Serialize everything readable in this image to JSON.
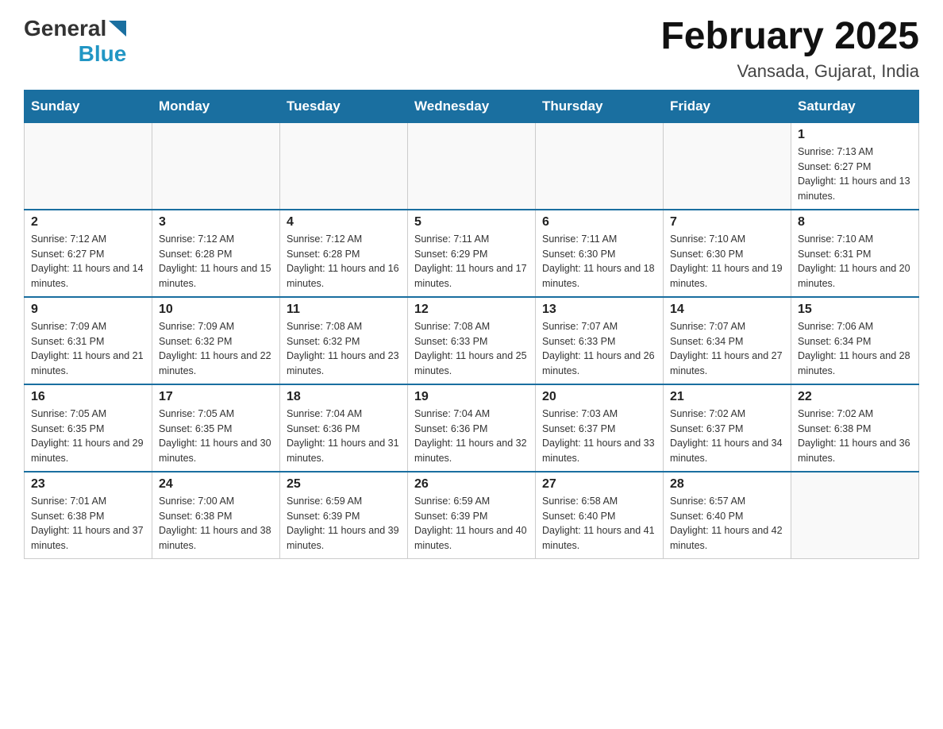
{
  "logo": {
    "general": "General",
    "blue": "Blue"
  },
  "title": "February 2025",
  "subtitle": "Vansada, Gujarat, India",
  "weekdays": [
    "Sunday",
    "Monday",
    "Tuesday",
    "Wednesday",
    "Thursday",
    "Friday",
    "Saturday"
  ],
  "weeks": [
    [
      {
        "day": "",
        "sunrise": "",
        "sunset": "",
        "daylight": ""
      },
      {
        "day": "",
        "sunrise": "",
        "sunset": "",
        "daylight": ""
      },
      {
        "day": "",
        "sunrise": "",
        "sunset": "",
        "daylight": ""
      },
      {
        "day": "",
        "sunrise": "",
        "sunset": "",
        "daylight": ""
      },
      {
        "day": "",
        "sunrise": "",
        "sunset": "",
        "daylight": ""
      },
      {
        "day": "",
        "sunrise": "",
        "sunset": "",
        "daylight": ""
      },
      {
        "day": "1",
        "sunrise": "Sunrise: 7:13 AM",
        "sunset": "Sunset: 6:27 PM",
        "daylight": "Daylight: 11 hours and 13 minutes."
      }
    ],
    [
      {
        "day": "2",
        "sunrise": "Sunrise: 7:12 AM",
        "sunset": "Sunset: 6:27 PM",
        "daylight": "Daylight: 11 hours and 14 minutes."
      },
      {
        "day": "3",
        "sunrise": "Sunrise: 7:12 AM",
        "sunset": "Sunset: 6:28 PM",
        "daylight": "Daylight: 11 hours and 15 minutes."
      },
      {
        "day": "4",
        "sunrise": "Sunrise: 7:12 AM",
        "sunset": "Sunset: 6:28 PM",
        "daylight": "Daylight: 11 hours and 16 minutes."
      },
      {
        "day": "5",
        "sunrise": "Sunrise: 7:11 AM",
        "sunset": "Sunset: 6:29 PM",
        "daylight": "Daylight: 11 hours and 17 minutes."
      },
      {
        "day": "6",
        "sunrise": "Sunrise: 7:11 AM",
        "sunset": "Sunset: 6:30 PM",
        "daylight": "Daylight: 11 hours and 18 minutes."
      },
      {
        "day": "7",
        "sunrise": "Sunrise: 7:10 AM",
        "sunset": "Sunset: 6:30 PM",
        "daylight": "Daylight: 11 hours and 19 minutes."
      },
      {
        "day": "8",
        "sunrise": "Sunrise: 7:10 AM",
        "sunset": "Sunset: 6:31 PM",
        "daylight": "Daylight: 11 hours and 20 minutes."
      }
    ],
    [
      {
        "day": "9",
        "sunrise": "Sunrise: 7:09 AM",
        "sunset": "Sunset: 6:31 PM",
        "daylight": "Daylight: 11 hours and 21 minutes."
      },
      {
        "day": "10",
        "sunrise": "Sunrise: 7:09 AM",
        "sunset": "Sunset: 6:32 PM",
        "daylight": "Daylight: 11 hours and 22 minutes."
      },
      {
        "day": "11",
        "sunrise": "Sunrise: 7:08 AM",
        "sunset": "Sunset: 6:32 PM",
        "daylight": "Daylight: 11 hours and 23 minutes."
      },
      {
        "day": "12",
        "sunrise": "Sunrise: 7:08 AM",
        "sunset": "Sunset: 6:33 PM",
        "daylight": "Daylight: 11 hours and 25 minutes."
      },
      {
        "day": "13",
        "sunrise": "Sunrise: 7:07 AM",
        "sunset": "Sunset: 6:33 PM",
        "daylight": "Daylight: 11 hours and 26 minutes."
      },
      {
        "day": "14",
        "sunrise": "Sunrise: 7:07 AM",
        "sunset": "Sunset: 6:34 PM",
        "daylight": "Daylight: 11 hours and 27 minutes."
      },
      {
        "day": "15",
        "sunrise": "Sunrise: 7:06 AM",
        "sunset": "Sunset: 6:34 PM",
        "daylight": "Daylight: 11 hours and 28 minutes."
      }
    ],
    [
      {
        "day": "16",
        "sunrise": "Sunrise: 7:05 AM",
        "sunset": "Sunset: 6:35 PM",
        "daylight": "Daylight: 11 hours and 29 minutes."
      },
      {
        "day": "17",
        "sunrise": "Sunrise: 7:05 AM",
        "sunset": "Sunset: 6:35 PM",
        "daylight": "Daylight: 11 hours and 30 minutes."
      },
      {
        "day": "18",
        "sunrise": "Sunrise: 7:04 AM",
        "sunset": "Sunset: 6:36 PM",
        "daylight": "Daylight: 11 hours and 31 minutes."
      },
      {
        "day": "19",
        "sunrise": "Sunrise: 7:04 AM",
        "sunset": "Sunset: 6:36 PM",
        "daylight": "Daylight: 11 hours and 32 minutes."
      },
      {
        "day": "20",
        "sunrise": "Sunrise: 7:03 AM",
        "sunset": "Sunset: 6:37 PM",
        "daylight": "Daylight: 11 hours and 33 minutes."
      },
      {
        "day": "21",
        "sunrise": "Sunrise: 7:02 AM",
        "sunset": "Sunset: 6:37 PM",
        "daylight": "Daylight: 11 hours and 34 minutes."
      },
      {
        "day": "22",
        "sunrise": "Sunrise: 7:02 AM",
        "sunset": "Sunset: 6:38 PM",
        "daylight": "Daylight: 11 hours and 36 minutes."
      }
    ],
    [
      {
        "day": "23",
        "sunrise": "Sunrise: 7:01 AM",
        "sunset": "Sunset: 6:38 PM",
        "daylight": "Daylight: 11 hours and 37 minutes."
      },
      {
        "day": "24",
        "sunrise": "Sunrise: 7:00 AM",
        "sunset": "Sunset: 6:38 PM",
        "daylight": "Daylight: 11 hours and 38 minutes."
      },
      {
        "day": "25",
        "sunrise": "Sunrise: 6:59 AM",
        "sunset": "Sunset: 6:39 PM",
        "daylight": "Daylight: 11 hours and 39 minutes."
      },
      {
        "day": "26",
        "sunrise": "Sunrise: 6:59 AM",
        "sunset": "Sunset: 6:39 PM",
        "daylight": "Daylight: 11 hours and 40 minutes."
      },
      {
        "day": "27",
        "sunrise": "Sunrise: 6:58 AM",
        "sunset": "Sunset: 6:40 PM",
        "daylight": "Daylight: 11 hours and 41 minutes."
      },
      {
        "day": "28",
        "sunrise": "Sunrise: 6:57 AM",
        "sunset": "Sunset: 6:40 PM",
        "daylight": "Daylight: 11 hours and 42 minutes."
      },
      {
        "day": "",
        "sunrise": "",
        "sunset": "",
        "daylight": ""
      }
    ]
  ]
}
